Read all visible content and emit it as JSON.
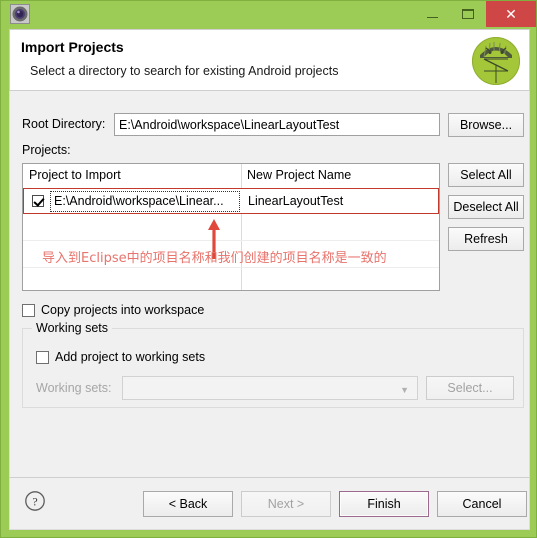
{
  "window": {
    "app_icon": "eclipse-gear-icon",
    "controls": {
      "minimize": "–",
      "maximize": "▢",
      "close": "✕"
    },
    "frame_color": "#9ccc56",
    "close_color": "#cf4646"
  },
  "header": {
    "title": "Import Projects",
    "subtitle": "Select a directory to search for existing Android projects",
    "logo": "android-robot-icon"
  },
  "form": {
    "root_directory_label": "Root Directory:",
    "root_directory_value": "E:\\Android\\workspace\\LinearLayoutTest",
    "browse_label": "Browse...",
    "projects_label": "Projects:"
  },
  "table": {
    "columns": [
      "Project to Import",
      "New Project Name"
    ],
    "rows": [
      {
        "checked": true,
        "project_to_import": "E:\\Android\\workspace\\Linear...",
        "new_project_name": "LinearLayoutTest"
      }
    ]
  },
  "side_buttons": [
    {
      "label": "Select All",
      "name": "select-all-button",
      "disabled": false
    },
    {
      "label": "Deselect All",
      "name": "deselect-all-button",
      "disabled": false
    },
    {
      "label": "Refresh",
      "name": "refresh-button",
      "disabled": false
    }
  ],
  "annotation": {
    "text": "导入到Eclipse中的项目名称和我们创建的项目名称是一致的",
    "color": "#e8736c",
    "arrow": "up-arrow-icon"
  },
  "options": {
    "copy_projects_label": "Copy projects into workspace",
    "copy_projects_checked": false,
    "working_sets_group": "Working sets",
    "add_project_label": "Add project to working sets",
    "add_project_checked": false,
    "working_sets_label": "Working sets:",
    "working_sets_value": "",
    "select_label": "Select..."
  },
  "footer": {
    "help": "?",
    "back_label": "< Back",
    "next_label": "Next >",
    "finish_label": "Finish",
    "cancel_label": "Cancel"
  }
}
